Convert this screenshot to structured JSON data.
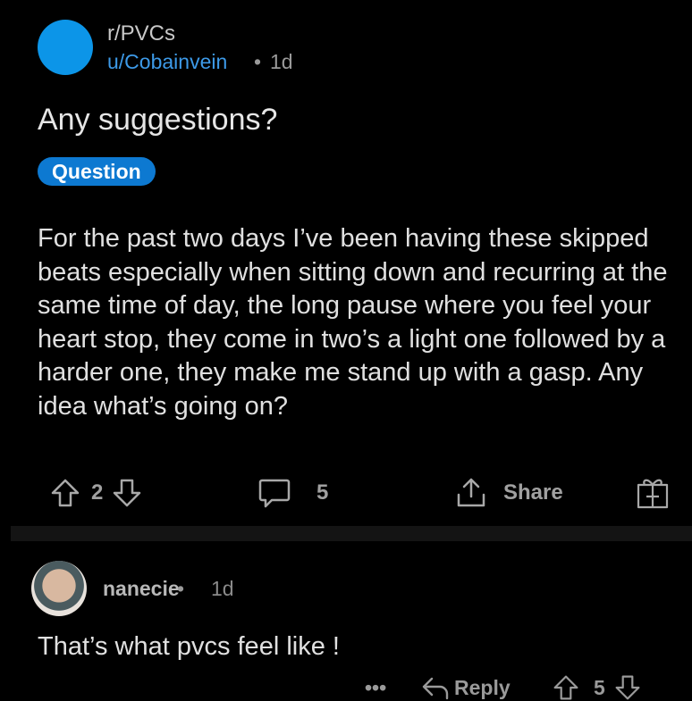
{
  "post": {
    "subreddit": "r/PVCs",
    "author": "u/Cobainvein",
    "separator": "•",
    "age": "1d",
    "title": "Any suggestions?",
    "flair": "Question",
    "body": "For the past two days I’ve been having these skipped beats especially when sitting down and recurring at the same time of day, the long pause where you feel your heart stop, they come in two’s a light one followed by a harder one, they make me stand up with a gasp. Any idea what’s going on?",
    "votes": "2",
    "comments": "5",
    "share_label": "Share"
  },
  "comment": {
    "author": "nanecie",
    "separator": "•",
    "age": "1d",
    "text": "That’s what pvcs feel like !",
    "more": "•••",
    "reply_label": "Reply",
    "votes": "5"
  },
  "colors": {
    "avatar": "#0c95e8",
    "flair": "#0d79d1",
    "author_link": "#3d9ae8"
  },
  "icons": [
    "upvote-icon",
    "downvote-icon",
    "comment-icon",
    "share-icon",
    "award-icon",
    "more-icon",
    "reply-icon"
  ]
}
